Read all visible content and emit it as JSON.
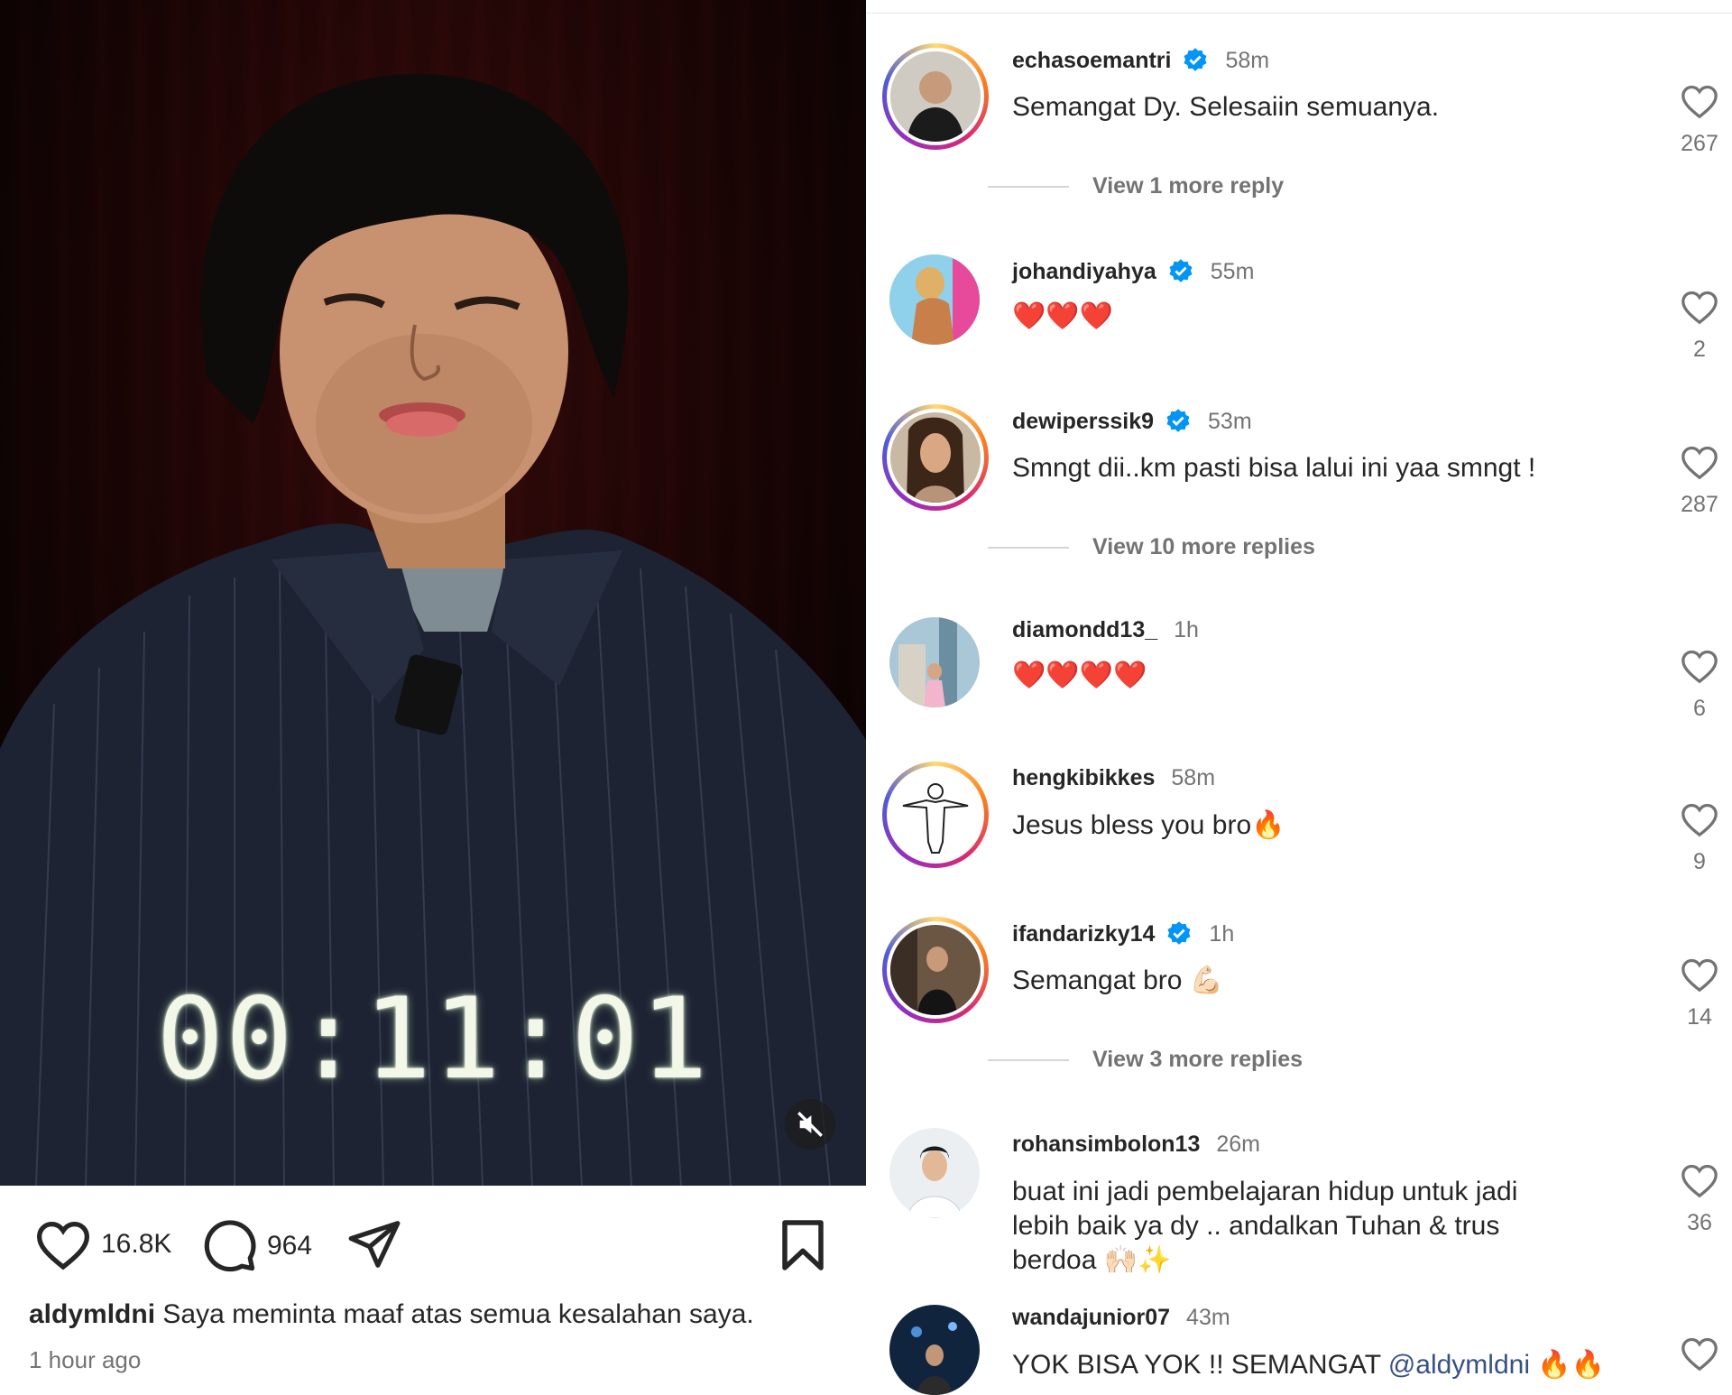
{
  "video": {
    "timer": "00:11:01"
  },
  "actions": {
    "likes": "16.8K",
    "comments": "964"
  },
  "caption": {
    "username": "aldymldni",
    "text": "Saya meminta maaf atas semua kesalahan saya.",
    "time_ago": "1 hour ago"
  },
  "comments": [
    {
      "username": "echasoemantri",
      "verified": true,
      "time": "58m",
      "text": "Semangat Dy. Selesaiin semuanya.",
      "likes": "267",
      "more_replies": "View 1 more reply"
    },
    {
      "username": "johandiyahya",
      "verified": true,
      "time": "55m",
      "text": "❤️❤️❤️",
      "likes": "2"
    },
    {
      "username": "dewiperssik9",
      "verified": true,
      "time": "53m",
      "text": "Smngt dii..km pasti bisa lalui ini yaa smngt !",
      "likes": "287",
      "more_replies": "View 10 more replies"
    },
    {
      "username": "diamondd13_",
      "verified": false,
      "time": "1h",
      "text": "❤️❤️❤️❤️",
      "likes": "6"
    },
    {
      "username": "hengkibikkes",
      "verified": false,
      "time": "58m",
      "text": "Jesus bless you bro🔥",
      "likes": "9"
    },
    {
      "username": "ifandarizky14",
      "verified": true,
      "time": "1h",
      "text": "Semangat bro 💪🏻",
      "likes": "14",
      "more_replies": "View 3 more replies"
    },
    {
      "username": "rohansimbolon13",
      "verified": false,
      "time": "26m",
      "text": "buat ini jadi pembelajaran hidup untuk jadi lebih baik ya dy .. andalkan Tuhan & trus berdoa 🙌🏻✨",
      "likes": "36"
    },
    {
      "username": "wandajunior07",
      "verified": false,
      "time": "43m",
      "text_before": "YOK BISA YOK !! SEMANGAT ",
      "mention": "@aldymldni",
      "text_after": " 🔥🔥"
    }
  ],
  "colors": {
    "verified_blue": "#0095f6",
    "muted_text": "#737373",
    "mention": "#385185"
  }
}
